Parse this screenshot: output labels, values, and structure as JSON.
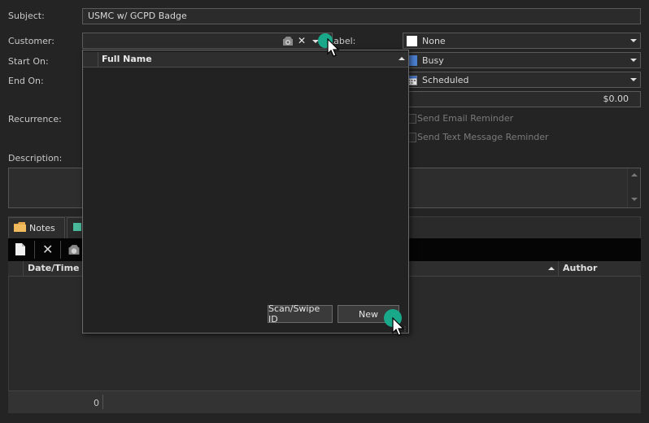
{
  "form": {
    "subject_label": "Subject:",
    "subject_value": "USMC w/ GCPD Badge",
    "customer_label": "Customer:",
    "start_label": "Start On:",
    "end_label": "End On:",
    "recurrence_label": "Recurrence:",
    "description_label": "Description:",
    "label_label": "Label:",
    "label_value": "None",
    "label_color": "#ffffff",
    "show_as_value": "Busy",
    "show_as_color": "#4a7fd0",
    "status_value": "Scheduled",
    "price_value": "$0.00",
    "send_email_label": "Send Email Reminder",
    "send_text_label": "Send Text Message Reminder"
  },
  "customer_dropdown": {
    "column_header": "Full Name",
    "scan_button": "Scan/Swipe ID",
    "new_button": "New"
  },
  "tabs": {
    "notes_label": "Notes"
  },
  "notes_grid": {
    "col_datetime": "Date/Time",
    "col_author": "Author",
    "count": "0"
  },
  "icons": {
    "notes_tab": "folder-icon",
    "new_note": "new-document-icon",
    "delete_note": "delete-x-icon",
    "camera": "camera-icon"
  }
}
